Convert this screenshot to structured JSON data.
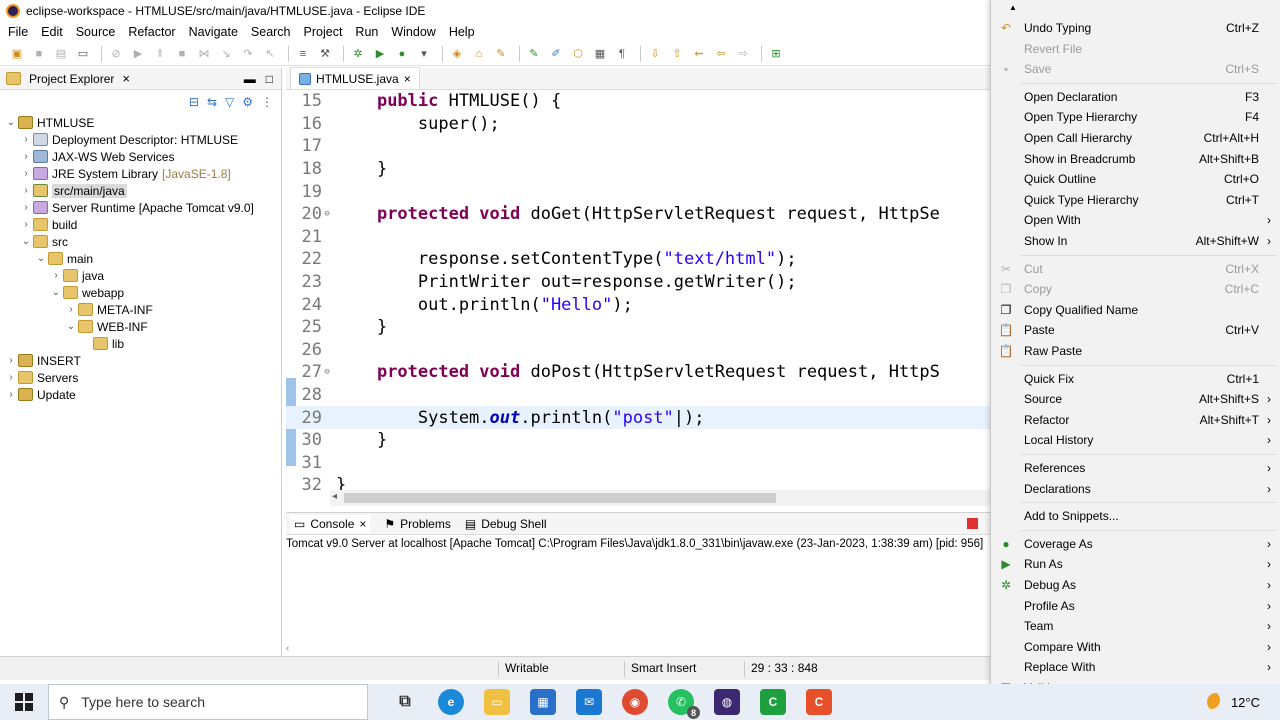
{
  "window": {
    "title": "eclipse-workspace - HTMLUSE/src/main/java/HTMLUSE.java - Eclipse IDE"
  },
  "menubar": [
    "File",
    "Edit",
    "Source",
    "Refactor",
    "Navigate",
    "Search",
    "Project",
    "Run",
    "Window",
    "Help"
  ],
  "explorer": {
    "title": "Project Explorer",
    "tree": [
      {
        "label": "HTMLUSE",
        "indent": 0,
        "twisty": "v",
        "icon": "proj"
      },
      {
        "label": "Deployment Descriptor: HTMLUSE",
        "indent": 1,
        "twisty": ">",
        "icon": "desc"
      },
      {
        "label": "JAX-WS Web Services",
        "indent": 1,
        "twisty": ">",
        "icon": "srv"
      },
      {
        "label": "JRE System Library",
        "decoration": "[JavaSE-1.8]",
        "indent": 1,
        "twisty": ">",
        "icon": "lib"
      },
      {
        "label": "src/main/java",
        "indent": 1,
        "twisty": ">",
        "icon": "src",
        "selected": true
      },
      {
        "label": "Server Runtime [Apache Tomcat v9.0]",
        "indent": 1,
        "twisty": ">",
        "icon": "lib"
      },
      {
        "label": "build",
        "indent": 1,
        "twisty": ">",
        "icon": "folder"
      },
      {
        "label": "src",
        "indent": 1,
        "twisty": "v",
        "icon": "folder"
      },
      {
        "label": "main",
        "indent": 2,
        "twisty": "v",
        "icon": "folder"
      },
      {
        "label": "java",
        "indent": 3,
        "twisty": ">",
        "icon": "folder"
      },
      {
        "label": "webapp",
        "indent": 3,
        "twisty": "v",
        "icon": "folder"
      },
      {
        "label": "META-INF",
        "indent": 4,
        "twisty": ">",
        "icon": "folder"
      },
      {
        "label": "WEB-INF",
        "indent": 4,
        "twisty": "v",
        "icon": "folder"
      },
      {
        "label": "lib",
        "indent": 5,
        "twisty": "",
        "icon": "folder"
      },
      {
        "label": "INSERT",
        "indent": 0,
        "twisty": ">",
        "icon": "proj"
      },
      {
        "label": "Servers",
        "indent": 0,
        "twisty": ">",
        "icon": "folder"
      },
      {
        "label": "Update",
        "indent": 0,
        "twisty": ">",
        "icon": "proj"
      }
    ]
  },
  "editor": {
    "tab": "HTMLUSE.java",
    "lines": [
      {
        "n": "15",
        "parts": [
          [
            "t",
            "    "
          ],
          [
            "kw",
            "public"
          ],
          [
            "t",
            " HTMLUSE() {"
          ]
        ]
      },
      {
        "n": "16",
        "parts": [
          [
            "t",
            "        super();"
          ]
        ]
      },
      {
        "n": "17",
        "parts": [
          [
            "t",
            ""
          ]
        ]
      },
      {
        "n": "18",
        "parts": [
          [
            "t",
            "    }"
          ]
        ]
      },
      {
        "n": "19",
        "parts": [
          [
            "t",
            ""
          ]
        ]
      },
      {
        "n": "20",
        "marker": "⊖",
        "parts": [
          [
            "t",
            "    "
          ],
          [
            "kw",
            "protected void"
          ],
          [
            "t",
            " doGet(HttpServletRequest request, HttpSe"
          ]
        ]
      },
      {
        "n": "21",
        "parts": [
          [
            "t",
            ""
          ]
        ]
      },
      {
        "n": "22",
        "parts": [
          [
            "t",
            "        response.setContentType("
          ],
          [
            "str",
            "\"text/html\""
          ],
          [
            "t",
            ");"
          ]
        ]
      },
      {
        "n": "23",
        "parts": [
          [
            "t",
            "        PrintWriter out=response.getWriter();"
          ]
        ]
      },
      {
        "n": "24",
        "parts": [
          [
            "t",
            "        out.println("
          ],
          [
            "str",
            "\"Hello\""
          ],
          [
            "t",
            ");"
          ]
        ]
      },
      {
        "n": "25",
        "parts": [
          [
            "t",
            "    }"
          ]
        ]
      },
      {
        "n": "26",
        "parts": [
          [
            "t",
            ""
          ]
        ]
      },
      {
        "n": "27",
        "marker": "⊖",
        "parts": [
          [
            "t",
            "    "
          ],
          [
            "kw",
            "protected void"
          ],
          [
            "t",
            " doPost(HttpServletRequest request, HttpS"
          ]
        ]
      },
      {
        "n": "28",
        "parts": [
          [
            "t",
            ""
          ]
        ]
      },
      {
        "n": "29",
        "current": true,
        "parts": [
          [
            "t",
            "        System."
          ],
          [
            "fld",
            "out"
          ],
          [
            "t",
            ".println("
          ],
          [
            "str",
            "\"post\""
          ],
          [
            "t",
            "|);"
          ]
        ]
      },
      {
        "n": "30",
        "parts": [
          [
            "t",
            "    }"
          ]
        ]
      },
      {
        "n": "31",
        "parts": [
          [
            "t",
            ""
          ]
        ]
      },
      {
        "n": "32",
        "parts": [
          [
            "t",
            "}"
          ]
        ]
      }
    ]
  },
  "console": {
    "tabs": [
      "Console",
      "Problems",
      "Debug Shell"
    ],
    "description": "Tomcat v9.0 Server at localhost [Apache Tomcat] C:\\Program Files\\Java\\jdk1.8.0_331\\bin\\javaw.exe  (23-Jan-2023, 1:38:39 am) [pid: 956]"
  },
  "statusbar": {
    "writable": "Writable",
    "insert": "Smart Insert",
    "position": "29 : 33 : 848"
  },
  "contextmenu": {
    "items": [
      {
        "type": "arrow",
        "label": "▲"
      },
      {
        "label": "Undo Typing",
        "shortcut": "Ctrl+Z",
        "icon": "↶"
      },
      {
        "label": "Revert File",
        "disabled": true
      },
      {
        "label": "Save",
        "shortcut": "Ctrl+S",
        "disabled": true,
        "icon": "▪"
      },
      {
        "type": "sep"
      },
      {
        "label": "Open Declaration",
        "shortcut": "F3"
      },
      {
        "label": "Open Type Hierarchy",
        "shortcut": "F4"
      },
      {
        "label": "Open Call Hierarchy",
        "shortcut": "Ctrl+Alt+H"
      },
      {
        "label": "Show in Breadcrumb",
        "shortcut": "Alt+Shift+B"
      },
      {
        "label": "Quick Outline",
        "shortcut": "Ctrl+O"
      },
      {
        "label": "Quick Type Hierarchy",
        "shortcut": "Ctrl+T"
      },
      {
        "label": "Open With",
        "submenu": true
      },
      {
        "label": "Show In",
        "shortcut": "Alt+Shift+W",
        "submenu": true
      },
      {
        "type": "sep"
      },
      {
        "label": "Cut",
        "shortcut": "Ctrl+X",
        "disabled": true,
        "icon": "✂"
      },
      {
        "label": "Copy",
        "shortcut": "Ctrl+C",
        "disabled": true,
        "icon": "❐"
      },
      {
        "label": "Copy Qualified Name",
        "icon": "❐"
      },
      {
        "label": "Paste",
        "shortcut": "Ctrl+V",
        "icon": "📋"
      },
      {
        "label": "Raw Paste",
        "icon": "📋"
      },
      {
        "type": "sep"
      },
      {
        "label": "Quick Fix",
        "shortcut": "Ctrl+1"
      },
      {
        "label": "Source",
        "shortcut": "Alt+Shift+S",
        "submenu": true
      },
      {
        "label": "Refactor",
        "shortcut": "Alt+Shift+T",
        "submenu": true
      },
      {
        "label": "Local History",
        "submenu": true
      },
      {
        "type": "sep"
      },
      {
        "label": "References",
        "submenu": true
      },
      {
        "label": "Declarations",
        "submenu": true
      },
      {
        "type": "sep"
      },
      {
        "label": "Add to Snippets..."
      },
      {
        "type": "sep"
      },
      {
        "label": "Coverage As",
        "submenu": true,
        "icon": "●"
      },
      {
        "label": "Run As",
        "submenu": true,
        "icon": "▶"
      },
      {
        "label": "Debug As",
        "submenu": true,
        "icon": "✲"
      },
      {
        "label": "Profile As",
        "submenu": true
      },
      {
        "label": "Team",
        "submenu": true
      },
      {
        "label": "Compare With",
        "submenu": true
      },
      {
        "label": "Replace With",
        "submenu": true
      },
      {
        "label": "Validate",
        "icon": "☑"
      },
      {
        "type": "arrow",
        "label": "▼"
      }
    ]
  },
  "taskbar": {
    "search_placeholder": "Type here to search",
    "temperature": "12°C",
    "whatsapp_badge": "8"
  },
  "colors": {
    "accent": "#3573c8",
    "keyword": "#7f0055",
    "string": "#2a00ff",
    "field": "#0000c0"
  }
}
